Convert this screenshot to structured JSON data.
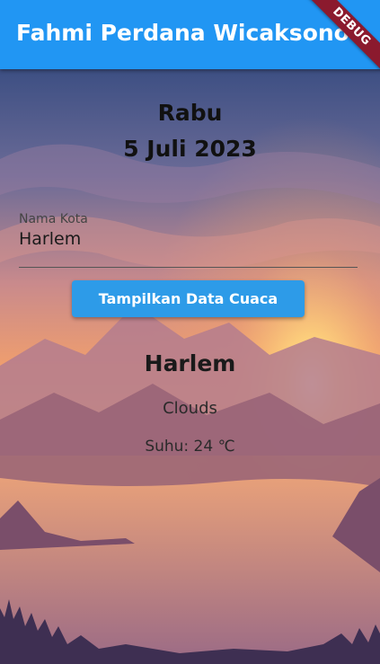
{
  "app_bar": {
    "title": "Fahmi Perdana Wicaksono"
  },
  "debug_banner": {
    "label": "DEBUG"
  },
  "header": {
    "day": "Rabu",
    "date": "5 Juli 2023"
  },
  "city_field": {
    "label": "Nama Kota",
    "value": "Harlem"
  },
  "button": {
    "label": "Tampilkan Data Cuaca"
  },
  "result": {
    "city": "Harlem",
    "weather": "Clouds",
    "temperature": "Suhu: 24 ℃"
  },
  "colors": {
    "app_bar": "#2196f3",
    "button": "#2d9be8",
    "banner": "#8b1a2e"
  }
}
